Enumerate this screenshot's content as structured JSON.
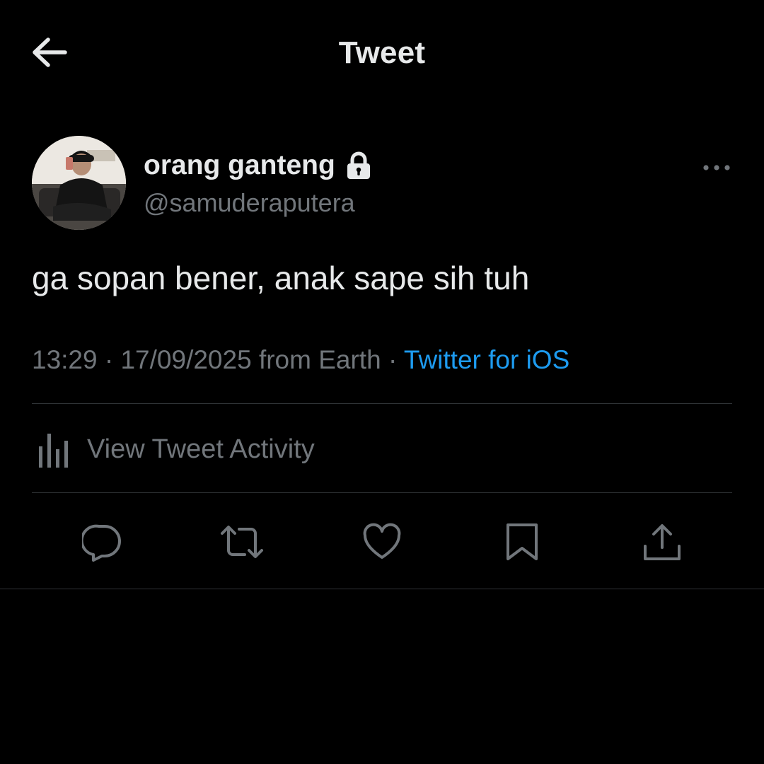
{
  "header": {
    "title": "Tweet",
    "back_icon": "arrow-left-icon"
  },
  "author": {
    "display_name": "orang ganteng",
    "handle": "@samuderaputera",
    "protected_icon": "lock-icon",
    "more_icon": "more-horizontal-icon"
  },
  "tweet": {
    "text": "ga sopan bener, anak sape sih tuh",
    "time": "13:29",
    "separator": " · ",
    "date": "17/09/2025",
    "location": " from Earth",
    "source_separator": " · ",
    "source": "Twitter for iOS"
  },
  "activity": {
    "label": "View Tweet Activity",
    "icon": "bar-chart-icon"
  },
  "actions": [
    {
      "name": "reply",
      "icon": "reply-icon"
    },
    {
      "name": "retweet",
      "icon": "retweet-icon"
    },
    {
      "name": "like",
      "icon": "heart-icon"
    },
    {
      "name": "bookmark",
      "icon": "bookmark-icon"
    },
    {
      "name": "share",
      "icon": "share-icon"
    }
  ],
  "colors": {
    "background": "#000000",
    "primary_text": "#e7e9ea",
    "secondary_text": "#71767b",
    "accent": "#1d9bf0",
    "divider": "#2f3336"
  }
}
